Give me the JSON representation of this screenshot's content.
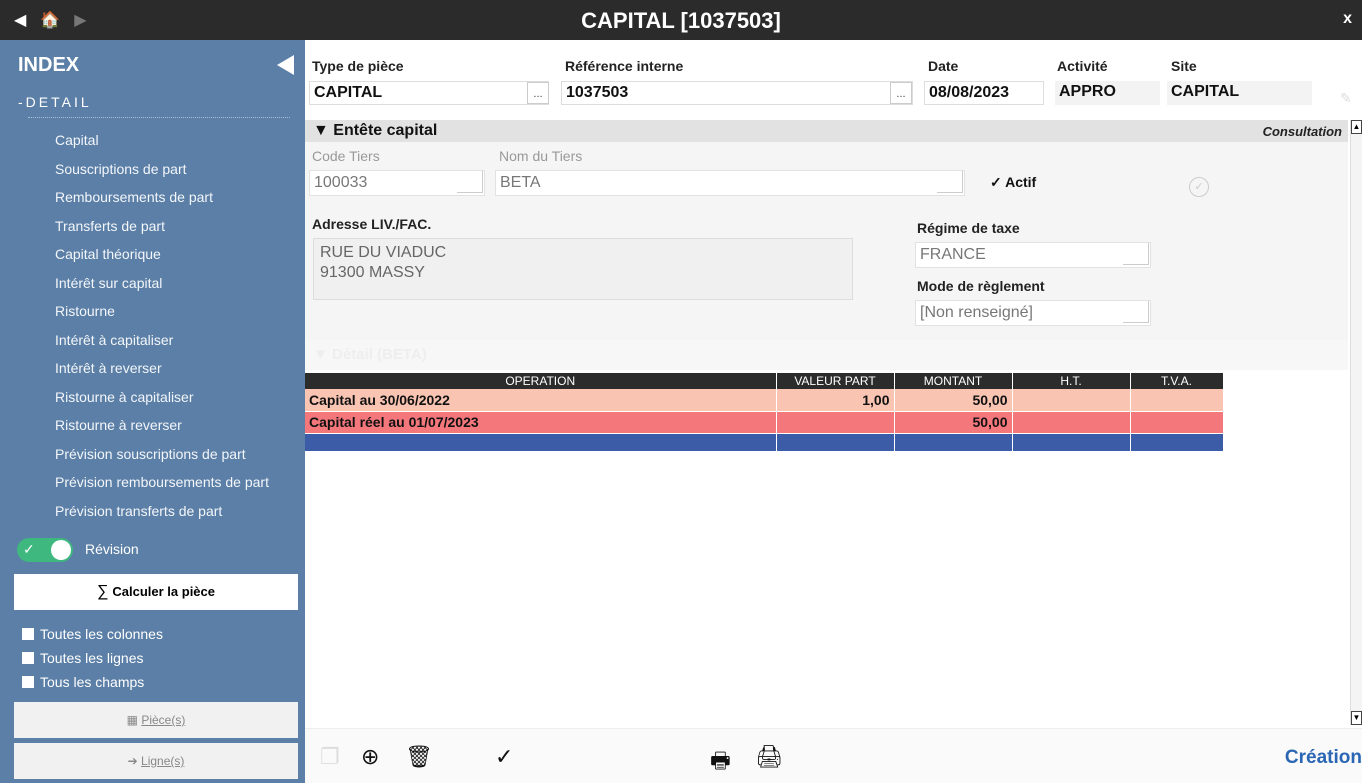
{
  "titlebar": {
    "title": "CAPITAL [1037503]",
    "close_label": "x",
    "back_icon": "◀",
    "home_icon": "🏠",
    "forward_icon": "▶"
  },
  "sidebar": {
    "index_label": "INDEX",
    "detail_label": "-DETAIL",
    "items": [
      "Capital",
      "Souscriptions de part",
      "Remboursements de part",
      "Transferts de part",
      "Capital théorique",
      "Intérêt sur capital",
      "Ristourne",
      "Intérêt à capitaliser",
      "Intérêt à reverser",
      "Ristourne à capitaliser",
      "Ristourne à reverser",
      "Prévision souscriptions de part",
      "Prévision remboursements de part",
      "Prévision transferts de part"
    ],
    "revision_label": "Révision",
    "calc_label": "Calculer la pièce",
    "checks": [
      "Toutes les colonnes",
      "Toutes les lignes",
      "Tous les champs"
    ],
    "pieces_label": "Pièce(s)",
    "lignes_label": "Ligne(s)"
  },
  "header": {
    "type_label": "Type de pièce",
    "type_value": "CAPITAL",
    "ref_label": "Référence interne",
    "ref_value": "1037503",
    "date_label": "Date",
    "date_value": "08/08/2023",
    "activite_label": "Activité",
    "activite_value": "APPRO",
    "site_label": "Site",
    "site_value": "CAPITAL",
    "dots": "..."
  },
  "entete": {
    "title": "▼ Entête capital",
    "mode": "Consultation",
    "code_tiers_label": "Code Tiers",
    "code_tiers_value": "100033",
    "nom_tiers_label": "Nom du Tiers",
    "nom_tiers_value": "BETA",
    "actif_label": "✓ Actif",
    "adresse_label": "Adresse LIV./FAC.",
    "adresse_line1": "RUE DU VIADUC",
    "adresse_line2": "91300  MASSY",
    "regime_label": "Régime de taxe",
    "regime_value": "FRANCE",
    "reglement_label": "Mode de règlement",
    "reglement_value": "[Non renseigné]"
  },
  "detail": {
    "title": "▼ Détail (BETA)",
    "columns": [
      "OPERATION",
      "VALEUR PART",
      "MONTANT",
      "H.T.",
      "T.V.A."
    ],
    "rows": [
      {
        "operation": "Capital au 30/06/2022",
        "valeur_part": "1,00",
        "montant": "50,00",
        "ht": "",
        "tva": ""
      },
      {
        "operation": "Capital réel au 01/07/2023",
        "valeur_part": "",
        "montant": "50,00",
        "ht": "",
        "tva": ""
      }
    ]
  },
  "footer": {
    "status": "Création"
  }
}
